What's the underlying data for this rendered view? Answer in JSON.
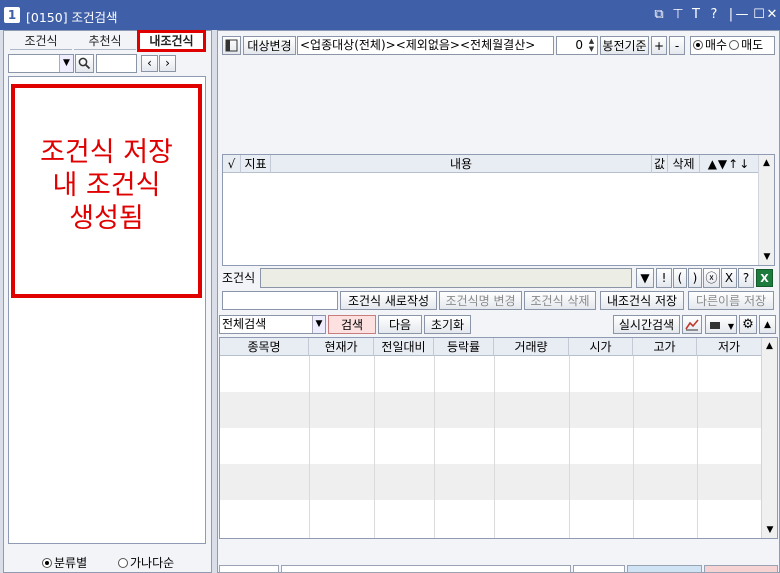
{
  "window": {
    "number": "1",
    "title": "[0150]  조건검색"
  },
  "left": {
    "tabs": [
      "조건식",
      "추천식",
      "내조건식"
    ],
    "annotation_lines": [
      "조건식 저장",
      "내 조건식",
      "생성됨"
    ],
    "radios": [
      "분류별",
      "가나다순"
    ]
  },
  "toolbar": {
    "target_change": "대상변경",
    "target_text": "<업종대상(전체)><제외없음><전체월결산>",
    "spin_value": "0",
    "bong_label": "봉전기준",
    "plus": "+",
    "minus": "-",
    "buy": "매수",
    "sell": "매도"
  },
  "cond_grid": {
    "headers": [
      "√",
      "지표",
      "내용",
      "값",
      "삭제",
      "▲▼↑↓"
    ]
  },
  "formula": {
    "label": "조건식",
    "ops": [
      "▼",
      "!",
      "(",
      ")",
      "ⓧ",
      "X",
      "?",
      "X"
    ]
  },
  "actions": {
    "new": "조건식 새로작성",
    "rename": "조건식명 변경",
    "delete": "조건식 삭제",
    "save": "내조건식 저장",
    "save_as": "다른이름 저장"
  },
  "search": {
    "mode": "전체검색",
    "search_btn": "검색",
    "next_btn": "다음",
    "reset_btn": "초기화",
    "realtime_btn": "실시간검색"
  },
  "results": {
    "headers": [
      "종목명",
      "현재가",
      "전일대비",
      "등락률",
      "거래량",
      "시가",
      "고가",
      "저가"
    ]
  }
}
